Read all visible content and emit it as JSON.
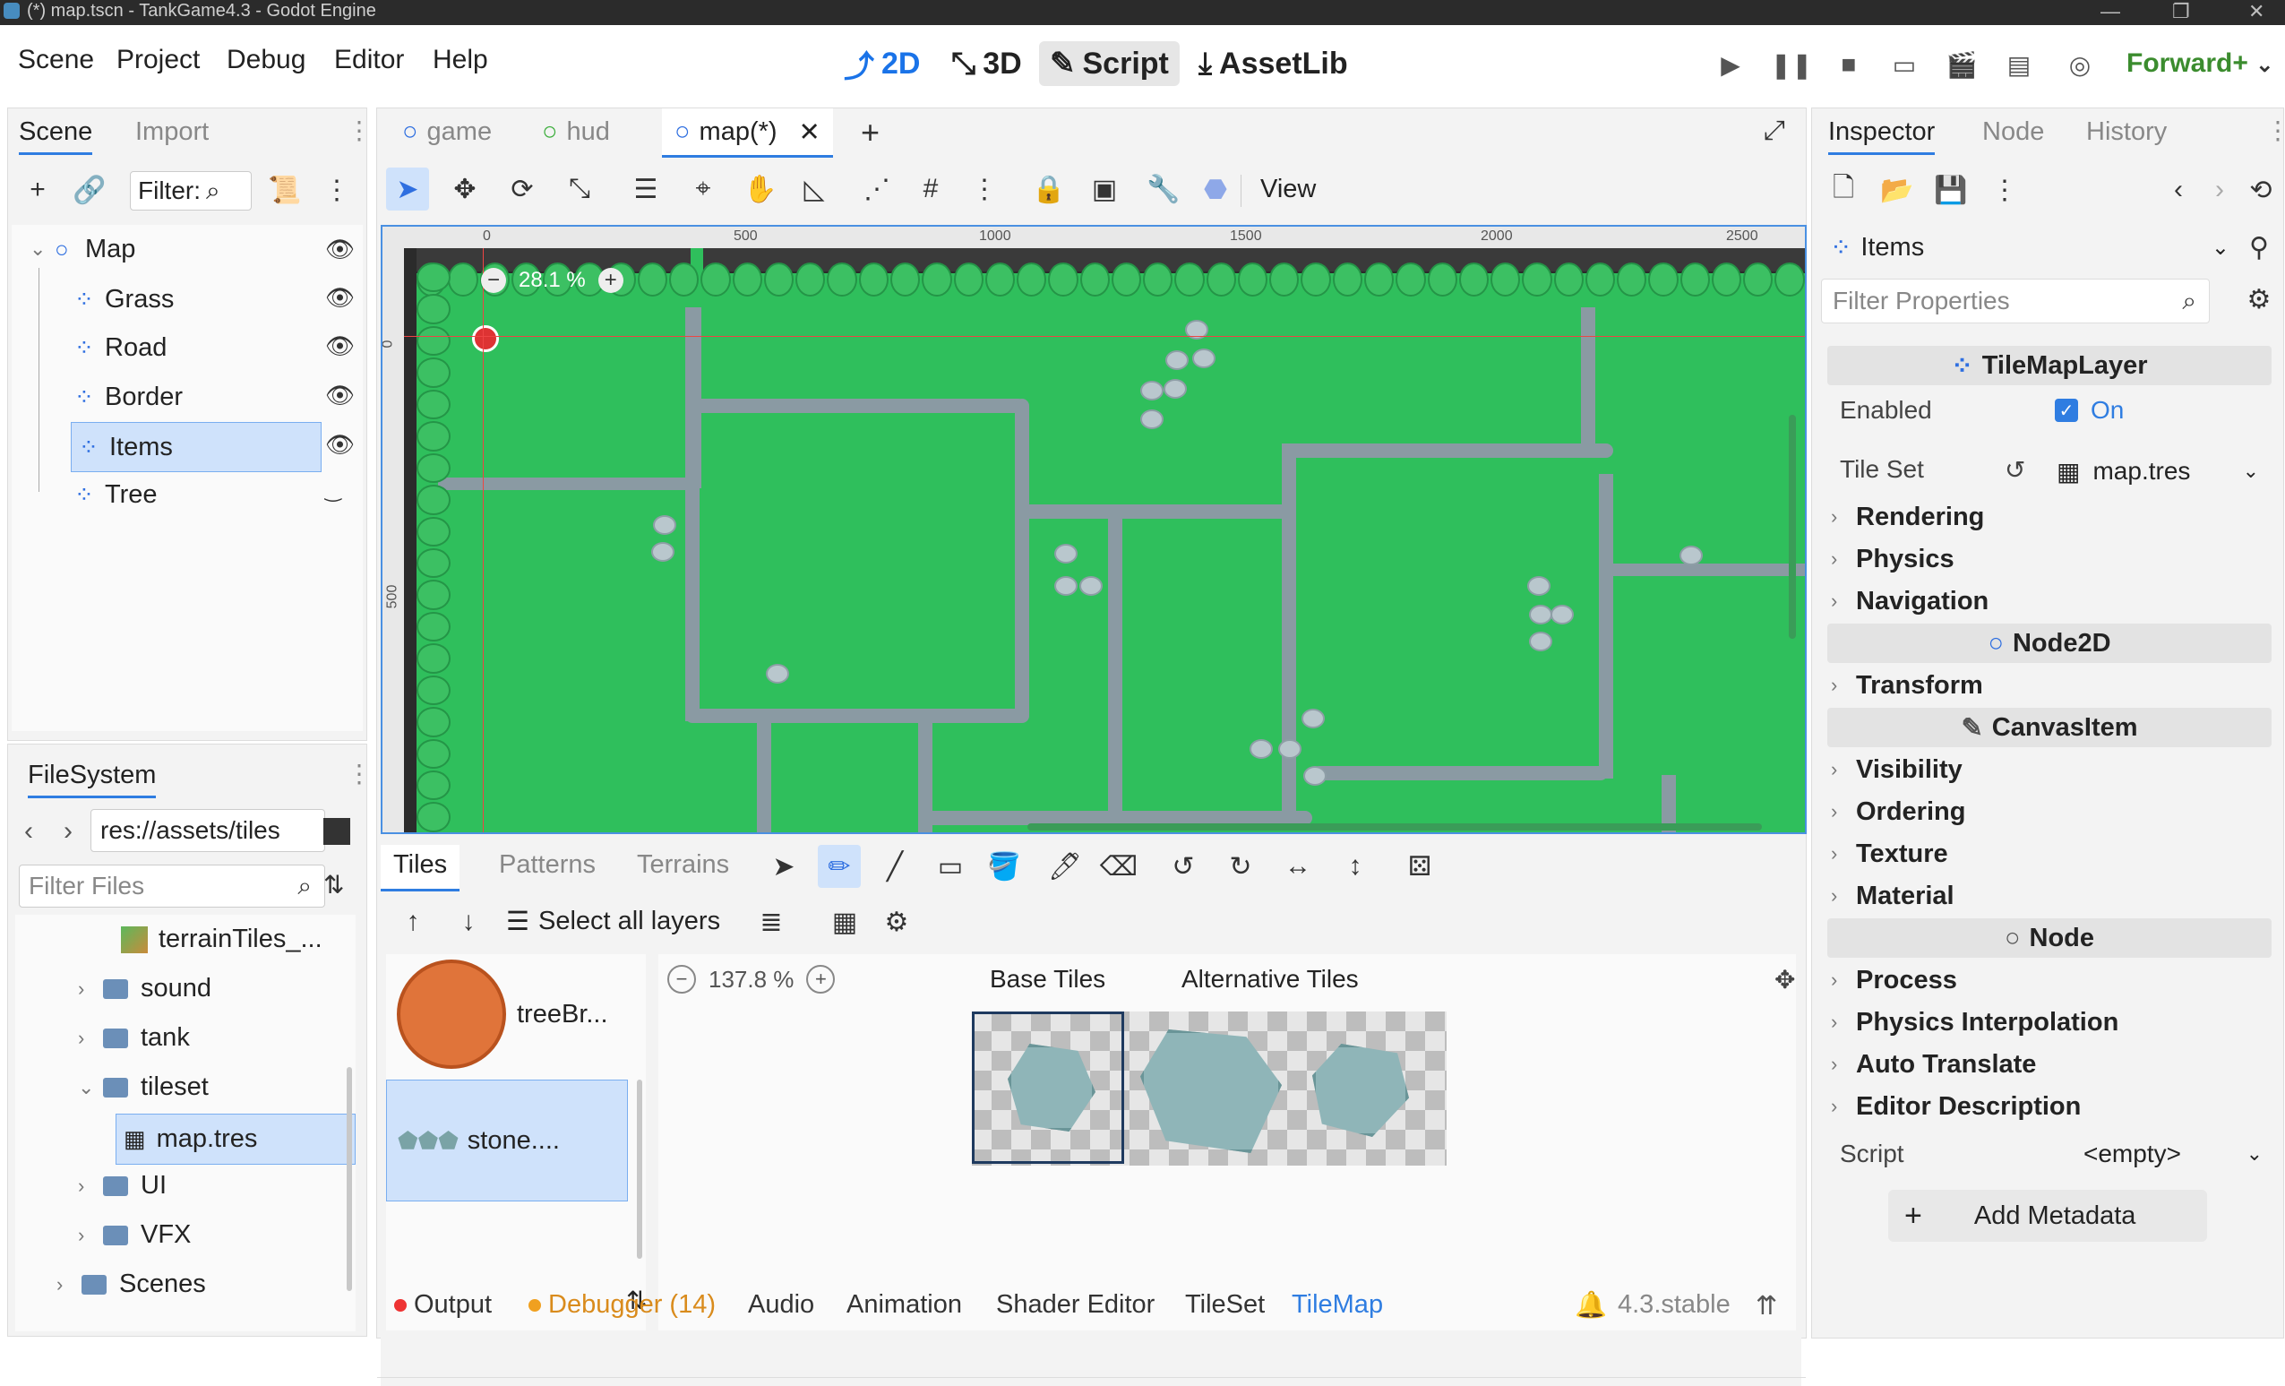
{
  "window": {
    "title": "(*) map.tscn - TankGame4.3 - Godot Engine"
  },
  "menu": {
    "items": [
      "Scene",
      "Project",
      "Debug",
      "Editor",
      "Help"
    ]
  },
  "modes": {
    "m2d": "2D",
    "m3d": "3D",
    "script": "Script",
    "assetlib": "AssetLib"
  },
  "renderer": "Forward+",
  "scene_dock": {
    "tabs": [
      "Scene",
      "Import"
    ],
    "filter_label": "Filter:",
    "nodes": [
      "Map",
      "Grass",
      "Road",
      "Border",
      "Items",
      "Tree"
    ]
  },
  "filesystem": {
    "tab": "FileSystem",
    "path": "res://assets/tiles",
    "filter_placeholder": "Filter Files",
    "items": [
      "terrainTiles_...",
      "sound",
      "tank",
      "tileset",
      "map.tres",
      "UI",
      "VFX",
      "Scenes"
    ]
  },
  "editor_tabs": [
    "game",
    "hud",
    "map(*)"
  ],
  "viewport": {
    "view_label": "View",
    "zoom": "28.1 %",
    "ruler_top": [
      "0",
      "500",
      "1000",
      "1500",
      "2000",
      "2500"
    ],
    "ruler_left": [
      "0",
      "500"
    ]
  },
  "tiles_panel": {
    "tabs": [
      "Tiles",
      "Patterns",
      "Terrains"
    ],
    "select_all_layers": "Select all layers",
    "sources": [
      "treeBr...",
      "stone...."
    ],
    "zoom": "137.8 %",
    "base_tiles": "Base Tiles",
    "alt_tiles": "Alternative Tiles"
  },
  "bottom_bar": {
    "tabs": [
      "Output",
      "Debugger (14)",
      "Audio",
      "Animation",
      "Shader Editor",
      "TileSet",
      "TileMap"
    ],
    "version": "4.3.stable"
  },
  "inspector": {
    "tabs": [
      "Inspector",
      "Node",
      "History"
    ],
    "object": "Items",
    "filter_placeholder": "Filter Properties",
    "class_tilemaplayer": "TileMapLayer",
    "enabled_label": "Enabled",
    "enabled_value": "On",
    "tileset_label": "Tile Set",
    "tileset_value": "map.tres",
    "groups_tml": [
      "Rendering",
      "Physics",
      "Navigation"
    ],
    "class_node2d": "Node2D",
    "groups_n2d": [
      "Transform"
    ],
    "class_canvas": "CanvasItem",
    "groups_canvas": [
      "Visibility",
      "Ordering",
      "Texture",
      "Material"
    ],
    "class_node": "Node",
    "groups_node": [
      "Process",
      "Physics Interpolation",
      "Auto Translate",
      "Editor Description"
    ],
    "script_label": "Script",
    "script_value": "<empty>",
    "add_metadata": "Add Metadata"
  },
  "colors": {
    "accent": "#2f7de1",
    "grass": "#2fbf5c",
    "road": "#8a9aa3",
    "selection": "#cfe2fb",
    "debugger": "#d98b1c"
  }
}
